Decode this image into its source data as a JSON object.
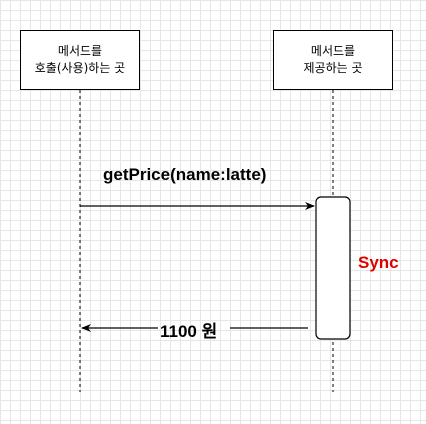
{
  "participants": [
    {
      "line1": "메서드를",
      "line2": "호출(사용)하는 곳"
    },
    {
      "line1": "메서드를",
      "line2": "제공하는 곳"
    }
  ],
  "messages": {
    "call": {
      "label": "getPrice(name:latte)"
    },
    "reply": {
      "label": "1100 원"
    }
  },
  "activation": {
    "label": "Sync",
    "label_color": "#e00000"
  }
}
